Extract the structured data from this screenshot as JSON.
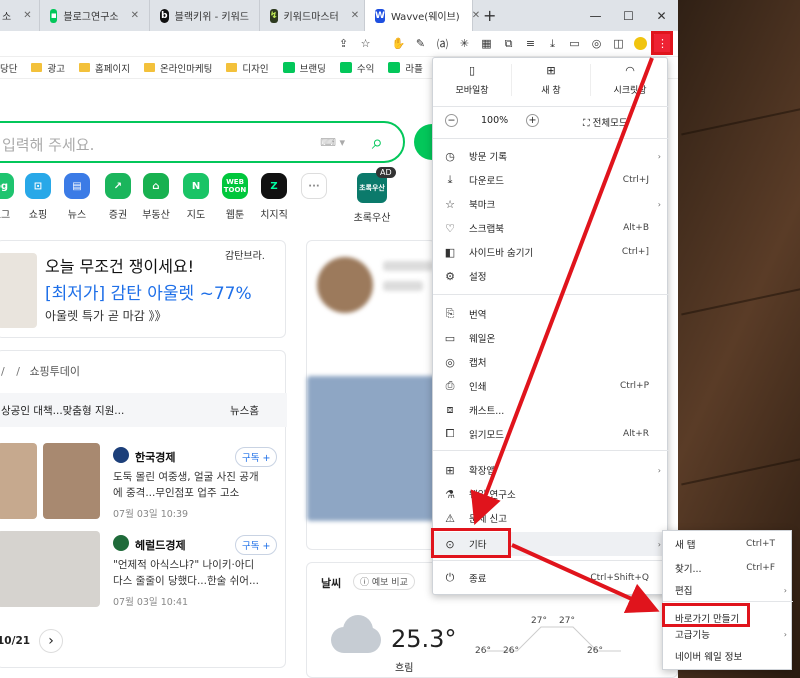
{
  "tabs": [
    {
      "label": "소",
      "icon": ""
    },
    {
      "label": "블로그연구소",
      "icon": "blog-icon"
    },
    {
      "label": "블랙키위 - 키워드",
      "icon": "blackkiwi-icon"
    },
    {
      "label": "키워드마스터",
      "icon": "keywordmaster-icon"
    },
    {
      "label": "Wavve(웨이브)",
      "icon": "wavve-icon"
    }
  ],
  "tab_close": "✕",
  "new_tab": "+",
  "window": {
    "minimize": "—",
    "maximize": "☐",
    "close": "✕"
  },
  "bookmarks": [
    "당단",
    "광고",
    "홈페이지",
    "온라인마케팅",
    "디자인",
    "브랜딩",
    "수익",
    "라플",
    "소"
  ],
  "search": {
    "placeholder": "입력해 주세요.",
    "kb": "⌨ ▾"
  },
  "shortcuts": [
    "로그",
    "쇼핑",
    "뉴스",
    "증권",
    "부동산",
    "지도",
    "웹툰",
    "치지직",
    "",
    "초록우산"
  ],
  "shortcut_badge": "AD",
  "promo": {
    "line1": "오늘 무조건 쟁이세요!",
    "line2": "[최저가] 감탄 아울렛 ~77%",
    "line3": "아울렛 특가 곧 마감 》》",
    "brand": "감탄브라."
  },
  "news": {
    "breadcrumb_sep": "/",
    "section": "쇼핑투데이",
    "headline": "상공인 대책...맞춤형 지원...",
    "headline_tag": "뉴스홈",
    "items": [
      {
        "press": "한국경제",
        "subscribe": "구독 +",
        "title1": "도둑 몰린 여중생, 얼굴 사진 공개",
        "title2": "에 중격...무인점포 업주 고소",
        "date": "07월 03일 10:39"
      },
      {
        "press": "헤럴드경제",
        "subscribe": "구독 +",
        "title1": "\"언제적 아식스냐?\" 나이키·아디",
        "title2": "다스 줄줄이 당했다...한술 쉬어...",
        "date": "07월 03일 10:41"
      }
    ],
    "page": "10/21",
    "next": "›"
  },
  "weather": {
    "title": "날씨",
    "compare": "예보 비교",
    "temp": "25.3°",
    "desc": "흐림",
    "chart_vals": [
      "27°",
      "27°",
      "26°",
      "26°",
      "26°"
    ]
  },
  "menu": {
    "top": [
      {
        "label": "모바일창",
        "icon": "mobile-icon"
      },
      {
        "label": "새 창",
        "icon": "new-window-icon"
      },
      {
        "label": "시크릿창",
        "icon": "secret-icon"
      }
    ],
    "zoom": {
      "minus": "−",
      "value": "100%",
      "plus": "+",
      "fullscreen": "전체모드"
    },
    "items": [
      {
        "label": "방문 기록",
        "shortcut": "",
        "arrow": "›"
      },
      {
        "label": "다운로드",
        "shortcut": "Ctrl+J",
        "arrow": ""
      },
      {
        "label": "북마크",
        "shortcut": "",
        "arrow": "›"
      },
      {
        "label": "스크랩북",
        "shortcut": "Alt+B",
        "arrow": ""
      },
      {
        "label": "사이드바 숨기기",
        "shortcut": "Ctrl+]",
        "arrow": ""
      },
      {
        "label": "설정",
        "shortcut": "",
        "arrow": ""
      },
      {
        "label": "번역",
        "shortcut": "",
        "arrow": ""
      },
      {
        "label": "웨일온",
        "shortcut": "",
        "arrow": ""
      },
      {
        "label": "캡처",
        "shortcut": "",
        "arrow": ""
      },
      {
        "label": "인쇄",
        "shortcut": "Ctrl+P",
        "arrow": ""
      },
      {
        "label": "캐스트...",
        "shortcut": "",
        "arrow": ""
      },
      {
        "label": "읽기모드",
        "shortcut": "Alt+R",
        "arrow": ""
      },
      {
        "label": "확장앱",
        "shortcut": "",
        "arrow": "›"
      },
      {
        "label": "웨일 연구소",
        "shortcut": "",
        "arrow": ""
      },
      {
        "label": "문제 신고",
        "shortcut": "",
        "arrow": ""
      },
      {
        "label": "기타",
        "shortcut": "",
        "arrow": "›"
      },
      {
        "label": "종료",
        "shortcut": "Ctrl+Shift+Q",
        "arrow": ""
      }
    ]
  },
  "submenu": [
    {
      "label": "새 탭",
      "shortcut": "Ctrl+T",
      "arrow": ""
    },
    {
      "label": "찾기...",
      "shortcut": "Ctrl+F",
      "arrow": ""
    },
    {
      "label": "편집",
      "shortcut": "",
      "arrow": "›"
    },
    {
      "label": "바로가기 만들기",
      "shortcut": "",
      "arrow": ""
    },
    {
      "label": "고급기능",
      "shortcut": "",
      "arrow": "›"
    },
    {
      "label": "네이버 웨일 정보",
      "shortcut": "",
      "arrow": ""
    }
  ],
  "colors": {
    "naver_green": "#03c75a",
    "highlight_red": "#e0141c",
    "link_blue": "#1e6fe8"
  }
}
